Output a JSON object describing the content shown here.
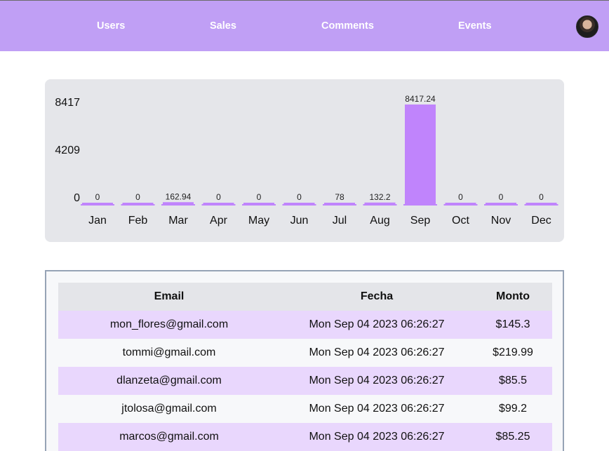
{
  "nav": {
    "links": [
      "Users",
      "Sales",
      "Comments",
      "Events"
    ]
  },
  "colors": {
    "nav_bg": "#c09ff5",
    "bar": "#c084fc",
    "card_bg": "#e5e6ea",
    "row_highlight": "#e9d7fd"
  },
  "chart_data": {
    "type": "bar",
    "categories": [
      "Jan",
      "Feb",
      "Mar",
      "Apr",
      "May",
      "Jun",
      "Jul",
      "Aug",
      "Sep",
      "Oct",
      "Nov",
      "Dec"
    ],
    "values": [
      0,
      0,
      162.94,
      0,
      0,
      0,
      78,
      132.2,
      8417.24,
      0,
      0,
      0
    ],
    "value_labels": [
      "0",
      "0",
      "162.94",
      "0",
      "0",
      "0",
      "78",
      "132.2",
      "8417.24",
      "0",
      "0",
      "0"
    ],
    "y_ticks": [
      "8417",
      "4209",
      "0"
    ],
    "ylim": [
      0,
      8417.24
    ],
    "grid": false
  },
  "table": {
    "headers": [
      "Email",
      "Fecha",
      "Monto"
    ],
    "rows": [
      [
        "mon_flores@gmail.com",
        "Mon Sep 04 2023 06:26:27",
        "$145.3"
      ],
      [
        "tommi@gmail.com",
        "Mon Sep 04 2023 06:26:27",
        "$219.99"
      ],
      [
        "dlanzeta@gmail.com",
        "Mon Sep 04 2023 06:26:27",
        "$85.5"
      ],
      [
        "jtolosa@gmail.com",
        "Mon Sep 04 2023 06:26:27",
        "$99.2"
      ],
      [
        "marcos@gmail.com",
        "Mon Sep 04 2023 06:26:27",
        "$85.25"
      ]
    ]
  }
}
